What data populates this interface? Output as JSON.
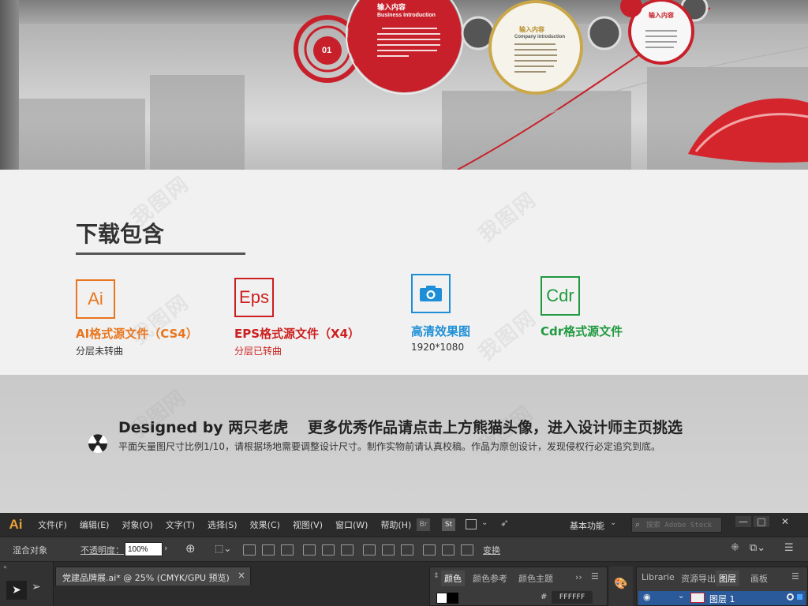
{
  "hero": {
    "panel_texts": [
      "输入内容",
      "Business Introduction",
      "01",
      "输入内容",
      "Company introduction",
      "输入内容"
    ]
  },
  "download": {
    "title": "下载包含",
    "formats": [
      {
        "icon_text": "Ai",
        "name": "AI格式源文件（CS4）",
        "sub": "分层未转曲",
        "color": "#e8761f"
      },
      {
        "icon_text": "Eps",
        "name": "EPS格式源文件（X4）",
        "sub": "分层已转曲",
        "color": "#cc1f1f"
      },
      {
        "icon_text": "",
        "icon": "camera-icon",
        "name": "高清效果图",
        "sub": "1920*1080",
        "color": "#1e8fd6"
      },
      {
        "icon_text": "Cdr",
        "name": "Cdr格式源文件",
        "sub": "",
        "color": "#1f9a3f"
      }
    ]
  },
  "designer": {
    "byline": "Designed by 两只老虎",
    "promo": "更多优秀作品请点击上方熊猫头像，进入设计师主页挑选",
    "note": "平面矢量图尺寸比例1/10，请根据场地需要调整设计尺寸。制作实物前请认真校稿。作品为原创设计，发现侵权行必定追究到底。"
  },
  "watermark": "我图网",
  "illustrator": {
    "logo": "Ai",
    "menu": [
      "文件(F)",
      "编辑(E)",
      "对象(O)",
      "文字(T)",
      "选择(S)",
      "效果(C)",
      "视图(V)",
      "窗口(W)",
      "帮助(H)"
    ],
    "bridge": "Br",
    "stock": "St",
    "workspace": "基本功能",
    "search_placeholder": "搜索 Adobe Stock",
    "window_controls": [
      "—",
      "□",
      "✕"
    ],
    "control": {
      "object_label": "混合对象",
      "opacity_label": "不透明度：",
      "opacity_value": "100%",
      "transform_label": "变换"
    },
    "doc_tab": "党建品牌展.ai* @ 25% (CMYK/GPU 预览)",
    "doc_close": "×",
    "panel_tabs_left": [
      "颜色",
      "颜色参考",
      "颜色主题"
    ],
    "panel_tabs_right": [
      "Librarie",
      "资源导出",
      "图层",
      "画板"
    ],
    "hex_value": "FFFFFF",
    "layer_name": "图层 1"
  }
}
